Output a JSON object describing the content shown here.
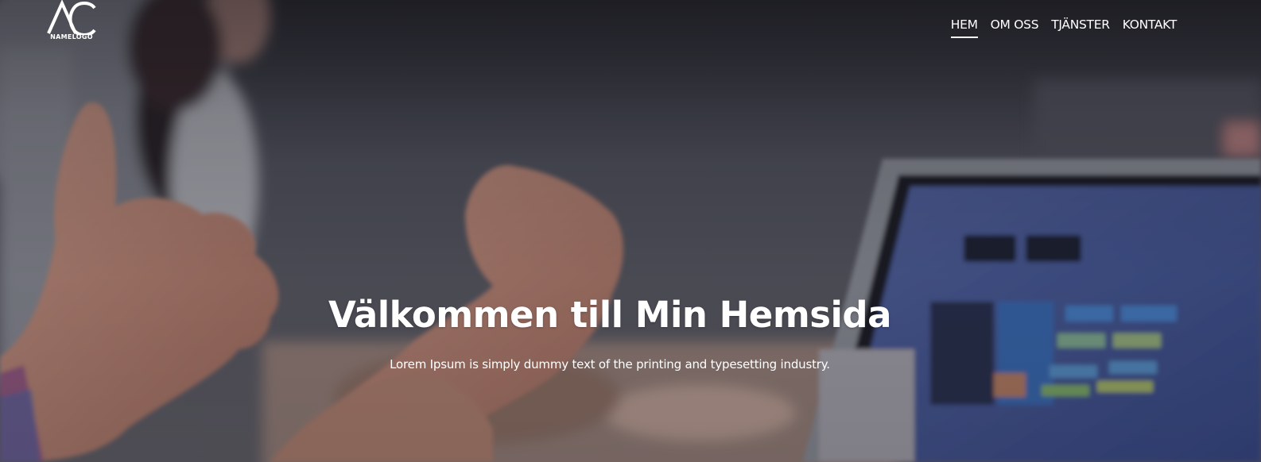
{
  "logo": {
    "icon": "ac-monogram-icon",
    "text": "NAMELOGO"
  },
  "nav": {
    "items": [
      {
        "label": "HEM",
        "active": true
      },
      {
        "label": "OM OSS",
        "active": false
      },
      {
        "label": "TJÄNSTER",
        "active": false
      },
      {
        "label": "KONTAKT",
        "active": false
      }
    ]
  },
  "hero": {
    "title": "Välkommen till Min Hemsida",
    "subtitle": "Lorem Ipsum is simply dummy text of the printing and typesetting industry."
  },
  "colors": {
    "text": "#ffffff",
    "overlay": "#121218"
  }
}
